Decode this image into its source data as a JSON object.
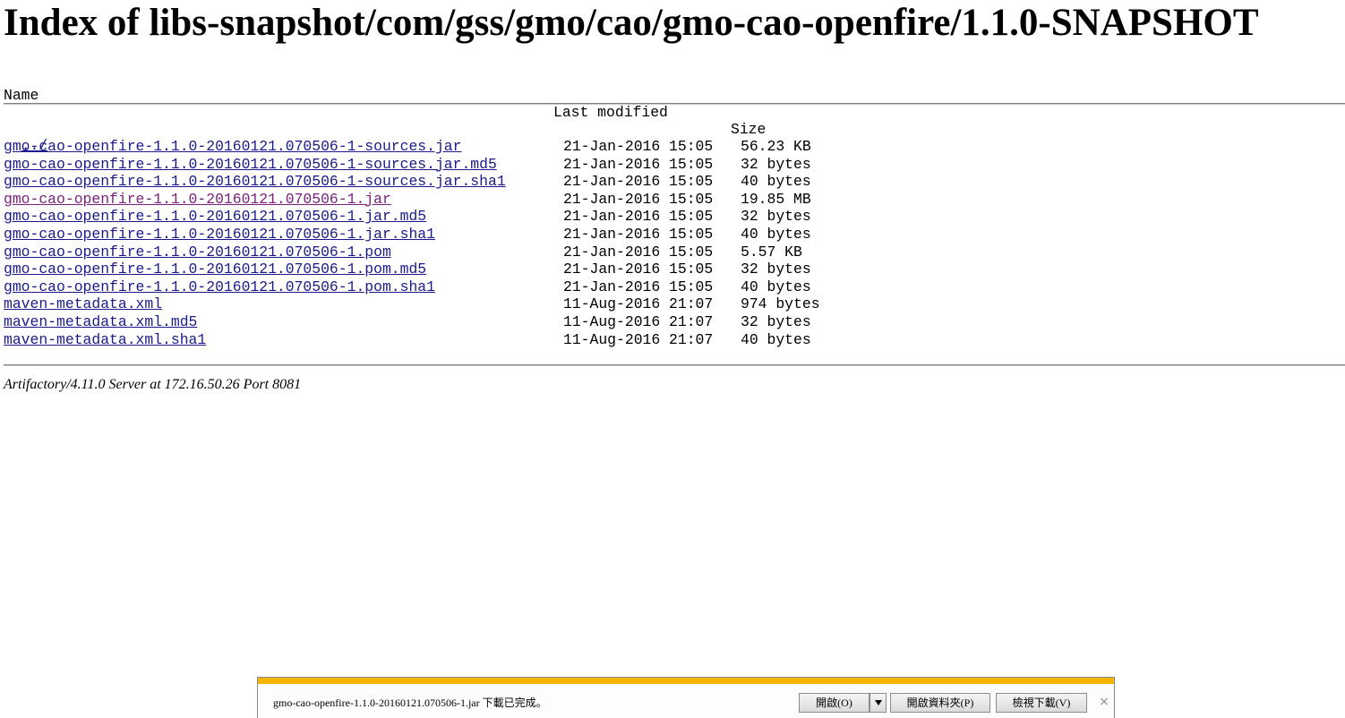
{
  "page": {
    "title": "Index of libs-snapshot/com/gss/gmo/cao/gmo-cao-openfire/1.1.0-SNAPSHOT"
  },
  "columns": {
    "name": "Name",
    "modified": "Last modified",
    "size": "Size"
  },
  "parent_link": "../",
  "files": [
    {
      "name": "gmo-cao-openfire-1.1.0-20160121.070506-1-sources.jar",
      "modified": "21-Jan-2016 15:05",
      "size": "56.23 KB",
      "visited": false
    },
    {
      "name": "gmo-cao-openfire-1.1.0-20160121.070506-1-sources.jar.md5",
      "modified": "21-Jan-2016 15:05",
      "size": "32 bytes",
      "visited": false
    },
    {
      "name": "gmo-cao-openfire-1.1.0-20160121.070506-1-sources.jar.sha1",
      "modified": "21-Jan-2016 15:05",
      "size": "40 bytes",
      "visited": false
    },
    {
      "name": "gmo-cao-openfire-1.1.0-20160121.070506-1.jar",
      "modified": "21-Jan-2016 15:05",
      "size": "19.85 MB",
      "visited": true
    },
    {
      "name": "gmo-cao-openfire-1.1.0-20160121.070506-1.jar.md5",
      "modified": "21-Jan-2016 15:05",
      "size": "32 bytes",
      "visited": false
    },
    {
      "name": "gmo-cao-openfire-1.1.0-20160121.070506-1.jar.sha1",
      "modified": "21-Jan-2016 15:05",
      "size": "40 bytes",
      "visited": false
    },
    {
      "name": "gmo-cao-openfire-1.1.0-20160121.070506-1.pom",
      "modified": "21-Jan-2016 15:05",
      "size": "5.57 KB",
      "visited": false
    },
    {
      "name": "gmo-cao-openfire-1.1.0-20160121.070506-1.pom.md5",
      "modified": "21-Jan-2016 15:05",
      "size": "32 bytes",
      "visited": false
    },
    {
      "name": "gmo-cao-openfire-1.1.0-20160121.070506-1.pom.sha1",
      "modified": "21-Jan-2016 15:05",
      "size": "40 bytes",
      "visited": false
    },
    {
      "name": "maven-metadata.xml",
      "modified": "11-Aug-2016 21:07",
      "size": "974 bytes",
      "visited": false
    },
    {
      "name": "maven-metadata.xml.md5",
      "modified": "11-Aug-2016 21:07",
      "size": "32 bytes",
      "visited": false
    },
    {
      "name": "maven-metadata.xml.sha1",
      "modified": "11-Aug-2016 21:07",
      "size": "40 bytes",
      "visited": false
    }
  ],
  "footer": {
    "server": "Artifactory/4.11.0 Server at 172.16.50.26 Port 8081"
  },
  "download_bar": {
    "message": "gmo-cao-openfire-1.1.0-20160121.070506-1.jar 下載已完成。",
    "open_label": "開啟(O)",
    "open_folder_label": "開啟資料夾(P)",
    "view_downloads_label": "檢視下載(V)",
    "close_glyph": "×",
    "accent_color": "#f4b400"
  },
  "colors": {
    "link": "#1a1a8c",
    "visited_link": "#7b1f7b"
  }
}
